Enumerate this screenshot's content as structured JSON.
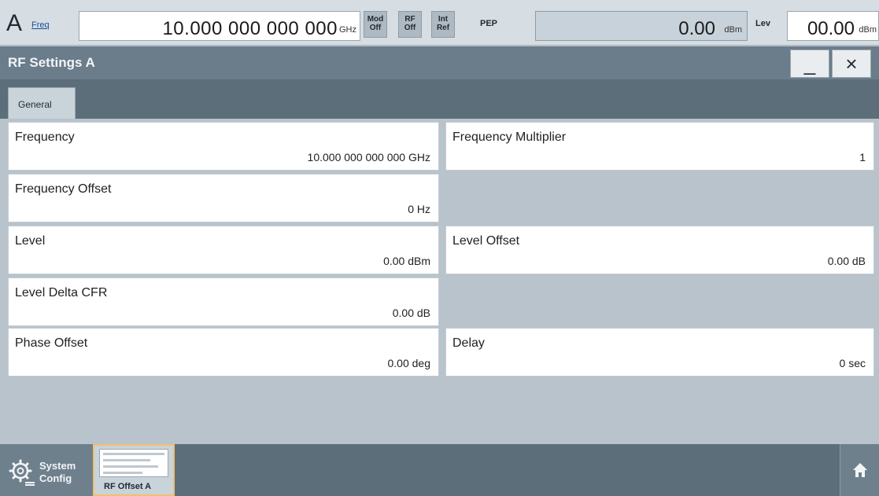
{
  "status_bar": {
    "path": "A",
    "freq_label": "Freq",
    "freq_value": "10.000 000 000 000",
    "freq_unit": "GHz",
    "badges": [
      {
        "line1": "Mod",
        "line2": "Off"
      },
      {
        "line1": "RF",
        "line2": "Off"
      },
      {
        "line1": "Int",
        "line2": "Ref"
      }
    ],
    "pep_label": "PEP",
    "pep_value": "0.00",
    "pep_unit": "dBm",
    "lev_label": "Lev",
    "lev_value": "00.00",
    "lev_unit": "dBm"
  },
  "dialog": {
    "title": "RF Settings A",
    "minimize_label": "_",
    "close_label": "×"
  },
  "tabs": [
    {
      "label": "General",
      "active": true
    }
  ],
  "fields": {
    "frequency": {
      "label": "Frequency",
      "value": "10.000 000 000 000  GHz"
    },
    "frequency_multiplier": {
      "label": "Frequency Multiplier",
      "value": "1"
    },
    "frequency_offset": {
      "label": "Frequency Offset",
      "value": "0  Hz"
    },
    "level": {
      "label": "Level",
      "value": "0.00  dBm"
    },
    "level_offset": {
      "label": "Level Offset",
      "value": "0.00  dB"
    },
    "level_delta_cfr": {
      "label": "Level Delta CFR",
      "value": "0.00  dB"
    },
    "phase_offset": {
      "label": "Phase Offset",
      "value": "0.00  deg"
    },
    "delay": {
      "label": "Delay",
      "value": "0  sec"
    }
  },
  "bottom_bar": {
    "system_config_line1": "System",
    "system_config_line2": "Config",
    "thumbnail_caption": "RF Offset A",
    "home_icon": "home-icon",
    "gear_icon": "gear-icon"
  },
  "colors": {
    "accent_thumb_border": "#f0c070",
    "freq_label": "#1c4fa0"
  }
}
